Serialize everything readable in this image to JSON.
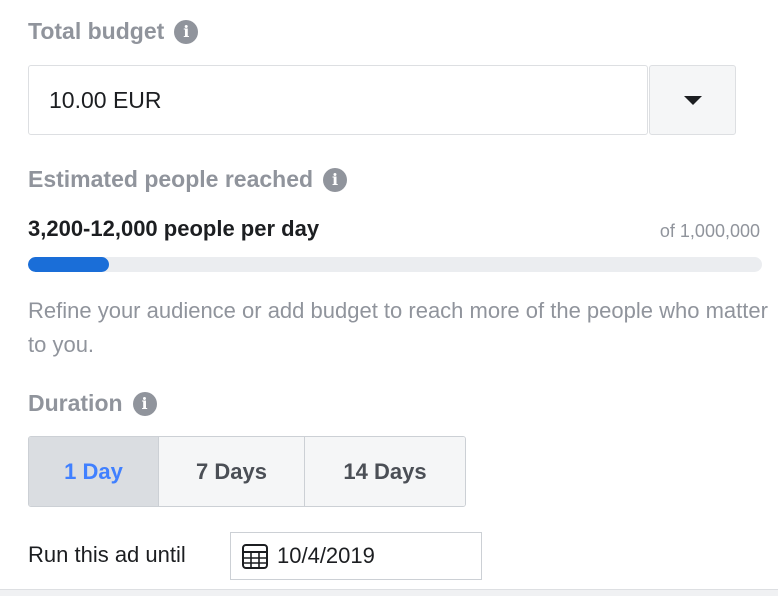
{
  "budget": {
    "label": "Total budget",
    "value": "10.00 EUR",
    "info_icon": "info-icon",
    "dropdown_icon": "caret-down-icon"
  },
  "reach": {
    "label": "Estimated people reached",
    "info_icon": "info-icon",
    "range_text": "3,200-12,000 people per day",
    "total_text": "of 1,000,000",
    "progress_fraction": 0.11,
    "progress_color": "#1a6ed8",
    "hint": "Refine your audience or add budget to reach more of the people who matter to you."
  },
  "duration": {
    "label": "Duration",
    "info_icon": "info-icon",
    "options": [
      "1 Day",
      "7 Days",
      "14 Days"
    ],
    "selected": "1 Day",
    "accent_color": "#4080ff"
  },
  "schedule": {
    "label": "Run this ad until",
    "date": "10/4/2019",
    "calendar_icon": "calendar-icon"
  }
}
